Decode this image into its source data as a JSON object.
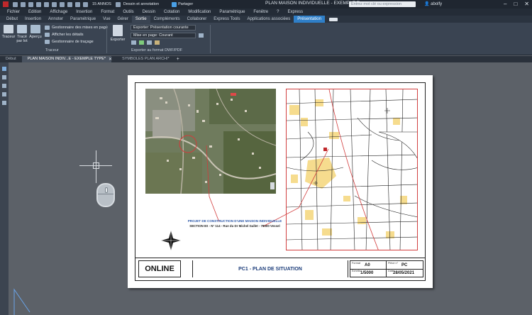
{
  "titlebar": {
    "workspace": "Dessin et annotation",
    "annos": "15 ANNOS",
    "share": "Partager",
    "document_title": "PLAN MAISON INDIVIDUELLE - EXEMPLE T...",
    "search_placeholder": "Entrez mot clé ou expression",
    "user": "abolfy"
  },
  "menu": [
    "Fichier",
    "Edition",
    "Affichage",
    "Insertion",
    "Format",
    "Outils",
    "Dessin",
    "Cotation",
    "Modification",
    "Paramétrique",
    "Fenêtre",
    "?",
    "Express"
  ],
  "ribbon_tabs": [
    "Début",
    "Insertion",
    "Annoter",
    "Paramétrique",
    "Vue",
    "Gérer",
    "Sortie",
    "Compléments",
    "Collaborer",
    "Express Tools",
    "Applications associées",
    "Présentation"
  ],
  "ribbon": {
    "traceur": "Traceur",
    "trace_par_lot": "Tracé par lot",
    "apercu": "Aperçu",
    "gestionnaire_mises_en_page": "Gestionnaire des mises en page",
    "afficher_details": "Afficher les détails",
    "gestionnaire_tracage": "Gestionnaire de traçage",
    "panel_traceur": "Traceur",
    "exporter": "Exporter",
    "export_select": "Exporter: Présentation courante",
    "mise_en_page_select": "Mise en page: Courant",
    "panel_export": "Exporter au format DWF/PDF"
  },
  "doc_tabs": [
    "Début",
    "PLAN MAISON INDIV...E - EXEMPLE TYPE*",
    "SYMBOLES PLAN ARCHI*"
  ],
  "sheet": {
    "caption_line1": "PROJET DE CONSTRUCTION D'UNE MAISON INDIVIDUELLE",
    "caption_line2": "SECTION 8X - N° 114 - Rue du Dr Michel Gallet - 78000 Vessel",
    "logo": "ONLINE",
    "title": "PC1 - PLAN DE SITUATION",
    "format_label": "Format",
    "format_value": "A0",
    "echelle_label": "Echelle",
    "echelle_value": "1/5000",
    "piece_label": "Pièce n°",
    "piece_value": "PC",
    "date_label": "Date",
    "date_value": "28/05/2021"
  },
  "colors": {
    "accent": "#2f7fc8",
    "title_blue": "#1d3d7a",
    "red": "#c0282b"
  }
}
